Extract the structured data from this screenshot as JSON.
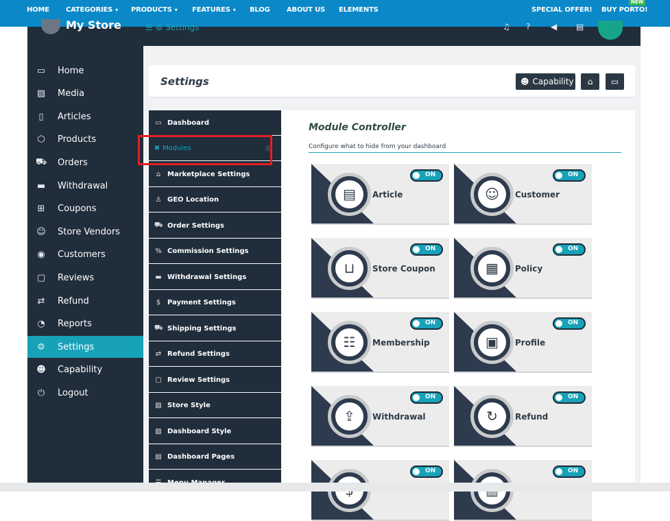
{
  "topnav": {
    "items": [
      "HOME",
      "CATEGORIES",
      "PRODUCTS",
      "FEATURES",
      "BLOG",
      "ABOUT US",
      "ELEMENTS"
    ],
    "special_offer": "SPECIAL OFFER!",
    "buy": "BUY PORTO!",
    "new_badge": "NEW"
  },
  "header": {
    "store_name": "My Store",
    "breadcrumb": "Settings"
  },
  "sidebar": {
    "items": [
      {
        "label": "Home",
        "icon": "monitor-icon"
      },
      {
        "label": "Media",
        "icon": "image-icon"
      },
      {
        "label": "Articles",
        "icon": "document-icon"
      },
      {
        "label": "Products",
        "icon": "cube-icon"
      },
      {
        "label": "Orders",
        "icon": "cart-icon"
      },
      {
        "label": "Withdrawal",
        "icon": "card-icon"
      },
      {
        "label": "Coupons",
        "icon": "gift-icon"
      },
      {
        "label": "Store Vendors",
        "icon": "user-icon"
      },
      {
        "label": "Customers",
        "icon": "user-circle-icon"
      },
      {
        "label": "Reviews",
        "icon": "comment-icon"
      },
      {
        "label": "Refund",
        "icon": "retweet-icon"
      },
      {
        "label": "Reports",
        "icon": "pie-chart-icon"
      },
      {
        "label": "Settings",
        "icon": "gears-icon",
        "active": true
      },
      {
        "label": "Capability",
        "icon": "user-x-icon"
      },
      {
        "label": "Logout",
        "icon": "power-icon"
      }
    ]
  },
  "page": {
    "title": "Settings",
    "capability_button": "Capability"
  },
  "submenu": {
    "items": [
      {
        "label": "Dashboard",
        "icon": "monitor-icon"
      },
      {
        "label": "Modules",
        "icon": "modules-icon",
        "active": true
      },
      {
        "label": "Marketplace Settings",
        "icon": "home-icon"
      },
      {
        "label": "GEO Location",
        "icon": "location-icon"
      },
      {
        "label": "Order Settings",
        "icon": "cart-icon"
      },
      {
        "label": "Commission Settings",
        "icon": "percent-icon"
      },
      {
        "label": "Withdrawal Settings",
        "icon": "card-icon"
      },
      {
        "label": "Payment Settings",
        "icon": "dollar-icon"
      },
      {
        "label": "Shipping Settings",
        "icon": "truck-icon"
      },
      {
        "label": "Refund Settings",
        "icon": "retweet-icon"
      },
      {
        "label": "Review Settings",
        "icon": "comment-icon"
      },
      {
        "label": "Store Style",
        "icon": "image-icon"
      },
      {
        "label": "Dashboard Style",
        "icon": "image-icon"
      },
      {
        "label": "Dashboard Pages",
        "icon": "pages-icon"
      },
      {
        "label": "Menu Manager",
        "icon": "menu-icon"
      }
    ]
  },
  "modules": {
    "title": "Module Controller",
    "subtitle": "Configure what to hide from your dashboard",
    "toggle_label": "ON",
    "cards": [
      {
        "name": "Article",
        "icon": "article-icon"
      },
      {
        "name": "Customer",
        "icon": "customer-icon"
      },
      {
        "name": "Store Coupon",
        "icon": "coupon-basket-icon"
      },
      {
        "name": "Policy",
        "icon": "policy-icon"
      },
      {
        "name": "Membership",
        "icon": "membership-icon"
      },
      {
        "name": "Profile",
        "icon": "profile-icon"
      },
      {
        "name": "Withdrawal",
        "icon": "withdrawal-icon"
      },
      {
        "name": "Refund",
        "icon": "refund-icon"
      },
      {
        "name": "",
        "icon": "money-icon"
      },
      {
        "name": "",
        "icon": "store-icon"
      }
    ]
  },
  "colors": {
    "accent": "#17a2b8",
    "dark": "#202d3b",
    "topnav": "#0a88c8",
    "highlight": "#e61e24"
  }
}
